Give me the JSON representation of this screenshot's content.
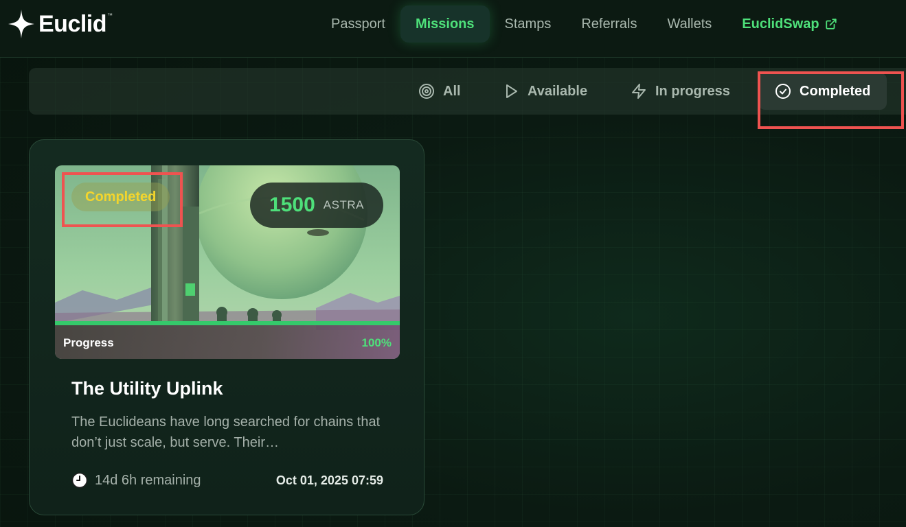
{
  "header": {
    "logo_text": "Euclid",
    "logo_tm": "™",
    "nav": [
      {
        "label": "Passport"
      },
      {
        "label": "Missions"
      },
      {
        "label": "Stamps"
      },
      {
        "label": "Referrals"
      },
      {
        "label": "Wallets"
      },
      {
        "label": "EuclidSwap"
      }
    ],
    "active_nav": "Missions"
  },
  "filters": {
    "items": [
      {
        "label": "All",
        "icon": "target-icon"
      },
      {
        "label": "Available",
        "icon": "play-icon"
      },
      {
        "label": "In progress",
        "icon": "lightning-icon"
      },
      {
        "label": "Completed",
        "icon": "check-circle-icon"
      }
    ],
    "active": "Completed"
  },
  "missions": [
    {
      "status": "Completed",
      "reward_amount": "1500",
      "reward_unit": "ASTRA",
      "progress_label": "Progress",
      "progress_value": "100%",
      "progress_fraction": 1.0,
      "title": "The Utility Uplink",
      "description": "The Euclideans have long searched for chains that don’t just scale, but serve. Their…",
      "remaining": "14d 6h remaining",
      "date": "Oct 01, 2025 07:59"
    }
  ],
  "colors": {
    "accent_green": "#4ee07a",
    "highlight_red": "#ef5350",
    "badge_yellow": "#f4d52c"
  }
}
